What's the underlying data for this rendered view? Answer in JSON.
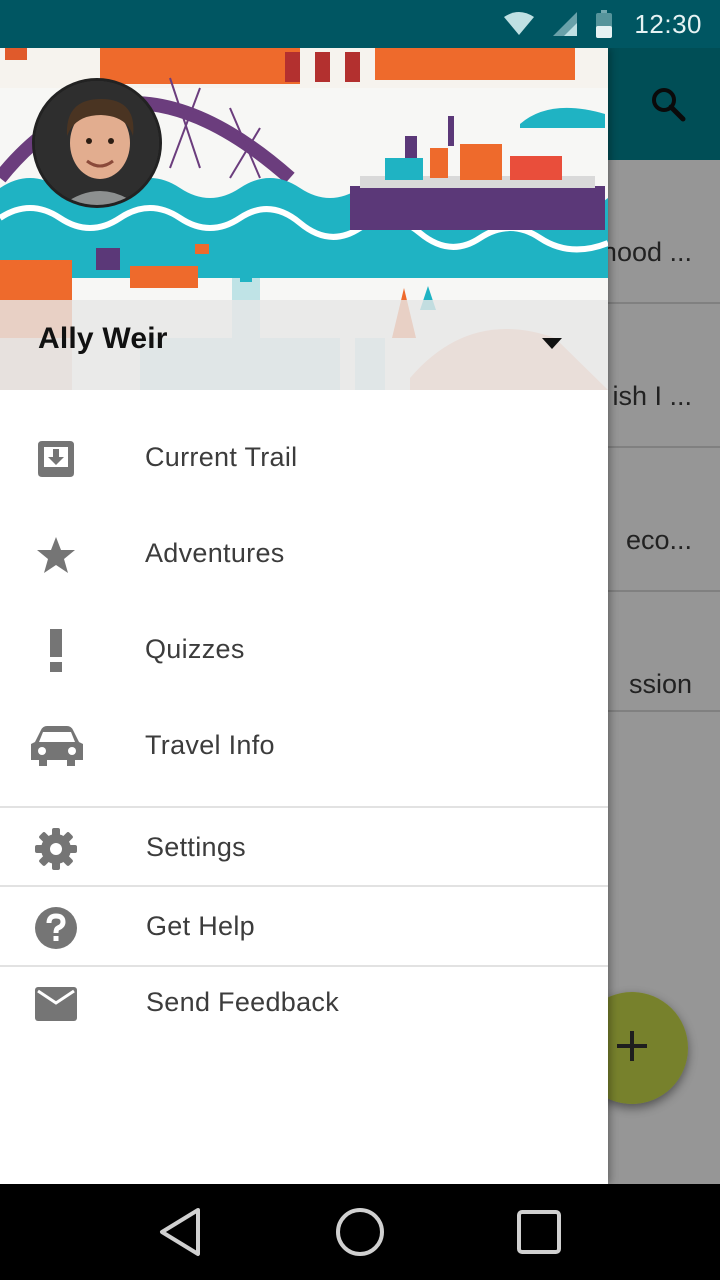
{
  "status_bar": {
    "time": "12:30",
    "icons": [
      "wifi-icon",
      "cell-signal-icon",
      "battery-icon"
    ]
  },
  "background_app": {
    "list_rows": [
      {
        "text": "hood ..."
      },
      {
        "text": "ish I ..."
      },
      {
        "text": "eco..."
      },
      {
        "text": "ssion"
      }
    ],
    "fab_icon": "plus-icon",
    "toolbar_icon": "search-icon"
  },
  "drawer": {
    "account": {
      "name": "Ally Weir"
    },
    "primary_items": [
      {
        "label": "Current Trail",
        "icon": "download-box-icon"
      },
      {
        "label": "Adventures",
        "icon": "star-icon"
      },
      {
        "label": "Quizzes",
        "icon": "exclamation-icon"
      },
      {
        "label": "Travel Info",
        "icon": "car-icon"
      }
    ],
    "secondary_items": [
      {
        "label": "Settings",
        "icon": "gear-icon"
      },
      {
        "label": "Get Help",
        "icon": "help-circle-icon"
      },
      {
        "label": "Send Feedback",
        "icon": "mail-icon"
      }
    ]
  },
  "navigation_bar": {
    "buttons": [
      "back-icon",
      "home-icon",
      "recents-icon"
    ]
  },
  "colors": {
    "status_bar": "#005662",
    "toolbar": "#00838f",
    "fab": "#c6d84a",
    "icon_gray": "#757575"
  }
}
